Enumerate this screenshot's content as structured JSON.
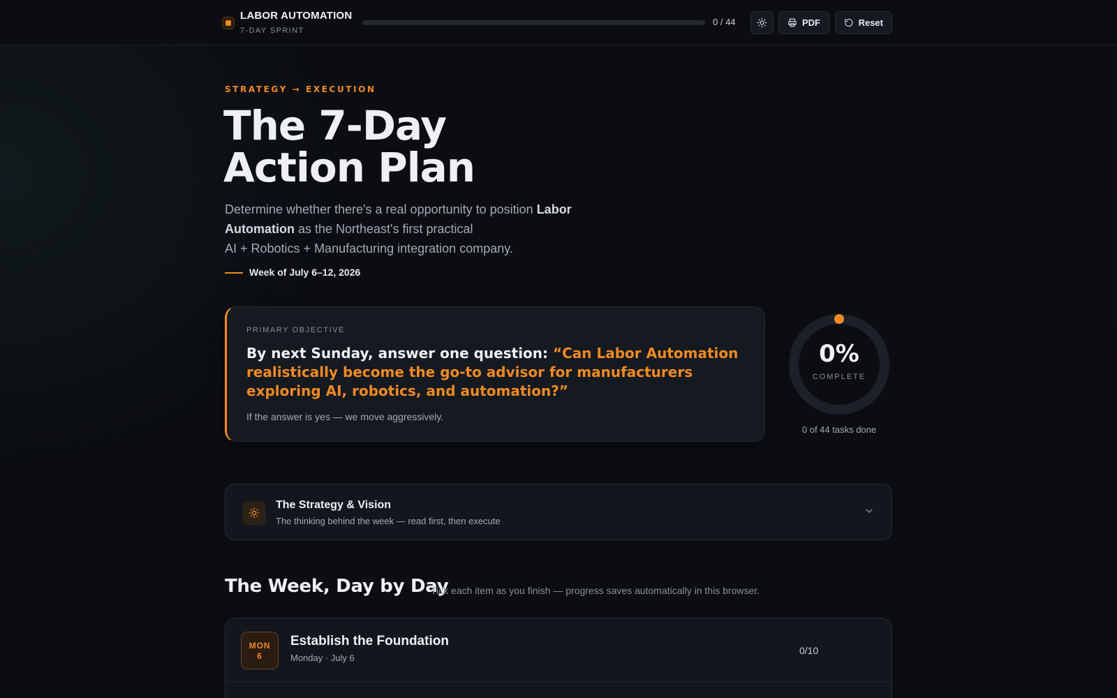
{
  "topbar": {
    "brand": "LABOR AUTOMATION",
    "brand_sub": "7-DAY SPRINT",
    "progress_fraction": 0,
    "progress_text": "0 / 44",
    "theme_icon": "sun-icon",
    "pdf_label": "PDF",
    "reset_label": "Reset"
  },
  "hero": {
    "eyebrow": "STRATEGY → EXECUTION",
    "title_line1": "The 7-Day",
    "title_line2": "Action Plan",
    "desc_part1": "Determine whether there's a real opportunity to position ",
    "desc_bold": "Labor Automation",
    "desc_part2": " as the Northeast's first practical",
    "desc_line3": "AI + Robotics + Manufacturing integration company.",
    "week": "Week of July 6–12, 2026"
  },
  "objective": {
    "label": "PRIMARY OBJECTIVE",
    "question_lead": "By next Sunday, answer one question: ",
    "question_highlight": "“Can Labor Automation realistically become the go-to advisor for manufacturers exploring AI, robotics, and automation?”",
    "note": "If the answer is yes — we move aggressively."
  },
  "completion": {
    "percent_text": "0%",
    "label": "COMPLETE",
    "caption": "0 of 44 tasks done",
    "fraction": 0
  },
  "strategy": {
    "title": "The Strategy & Vision",
    "subtitle": "The thinking behind the week — read first, then execute"
  },
  "week_section": {
    "title": "The Week, Day by Day",
    "note": "Tick each item as you finish — progress saves automatically in this browser."
  },
  "days": [
    {
      "badge_day": "MON",
      "badge_num": "6",
      "title": "Establish the Foundation",
      "date": "Monday · July 6",
      "count": "0/10"
    }
  ],
  "colors": {
    "accent": "#f08a24",
    "background": "#0b0d11",
    "card": "#151920"
  }
}
